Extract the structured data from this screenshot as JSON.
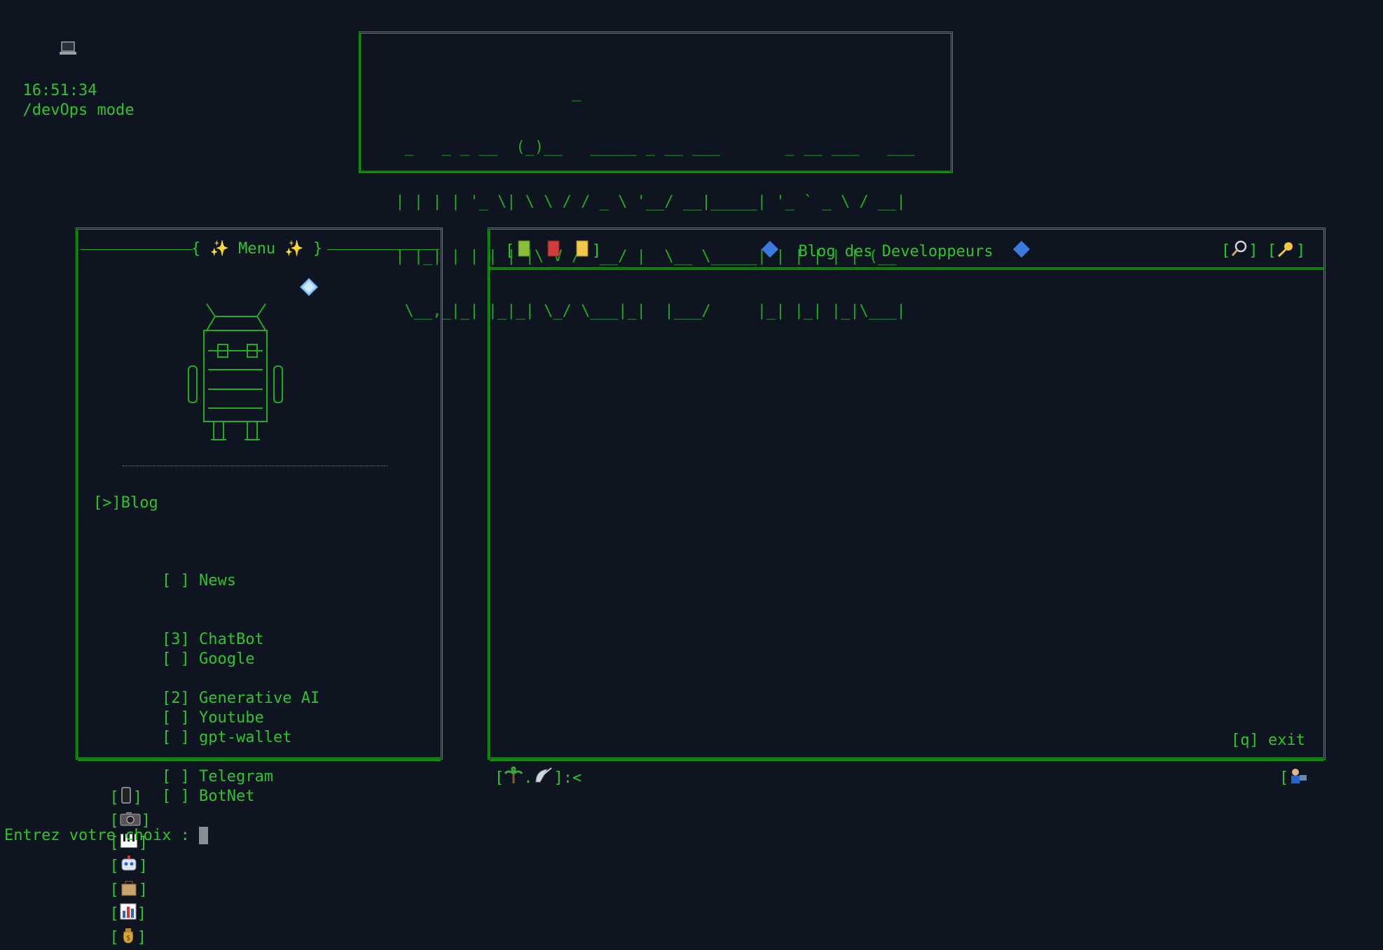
{
  "topbar": {
    "time": "16:51:34",
    "mode": "/devOps mode"
  },
  "banner": {
    "ascii": [
      "                    _                             ",
      "  _   _ _ __  (_)__   _____ _ __ ___       _ __ ___   ___ ",
      " | | | | '_ \\| \\ \\ / / _ \\ '__/ __|_____| '_ ` _ \\ / __|",
      " | |_| | | | | |\\ V /  __/ |  \\__ \\_____| | | | | | (__ ",
      "  \\__,_|_| |_|_| \\_/ \\___|_|  |___/     |_| |_| |_|\\___|"
    ],
    "logo_text": "univers-mc"
  },
  "menu_panel": {
    "title": "Menu",
    "current_section": "[>]Blog",
    "items_group1": [
      {
        "mark": "[ ]",
        "label": "News"
      },
      {
        "mark": "[3]",
        "label": "ChatBot"
      },
      {
        "mark": "[2]",
        "label": "Generative AI"
      }
    ],
    "items_group2": [
      {
        "mark": "[ ]",
        "label": "Google"
      },
      {
        "mark": "[ ]",
        "label": "Youtube"
      },
      {
        "mark": "[ ]",
        "label": "Telegram"
      }
    ],
    "items_group3": [
      {
        "mark": "[ ]",
        "label": "gpt-wallet"
      },
      {
        "mark": "[ ]",
        "label": "BotNet"
      }
    ],
    "footer_icons": [
      "phone-icon",
      "camera-icon",
      "piano-icon",
      "robot-icon",
      "shopping-bag-icon",
      "bar-chart-icon",
      "money-bag-icon"
    ]
  },
  "blog_panel": {
    "title": "Blog des Developpeurs",
    "header_icons_left": [
      "green-book-icon",
      "red-book-icon",
      "notebook-icon"
    ],
    "header_icons_right": [
      "magnifier-icon",
      "comet-icon"
    ],
    "exit_hint": "[q] exit",
    "footer_prompt": "]:<",
    "footer_icons": [
      "palm-tree-icon",
      "satellite-icon",
      "user-computer-icon"
    ]
  },
  "prompt": {
    "label": "Entrez votre choix : "
  },
  "colors": {
    "bg": "#0e1520",
    "fg": "#2ec42e",
    "border": "#1fae1f"
  }
}
